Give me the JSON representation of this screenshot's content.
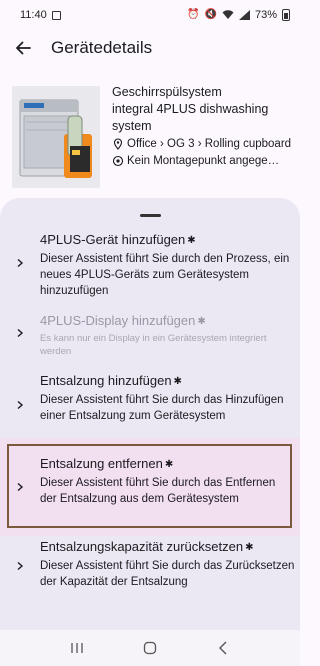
{
  "status_bar": {
    "time": "11:40",
    "battery": "73%"
  },
  "app_bar": {
    "title": "Gerätedetails"
  },
  "product": {
    "name": "Geschirrspülsystem",
    "model": "integral 4PLUS dishwashing system",
    "location": "Office › OG 3 › Rolling cupboard",
    "mount": "Kein Montagepunkt angege…"
  },
  "actions": [
    {
      "title": "4PLUS-Gerät hinzufügen",
      "desc": "Dieser Assistent führt Sie durch den Prozess, ein neues 4PLUS-Geräts zum Gerätesystem hinzuzufügen",
      "enabled": true
    },
    {
      "title": "4PLUS-Display hinzufügen",
      "desc": "Es kann nur ein Display in ein Gerätesystem integriert werden",
      "enabled": false
    },
    {
      "title": "Entsalzung hinzufügen",
      "desc": "Dieser Assistent führt Sie durch das Hinzufügen einer Entsalzung zum Gerätesystem",
      "enabled": true
    },
    {
      "title": "Entsalzung entfernen",
      "desc": "Dieser Assistent führt Sie durch das Entfernen der Entsalzung aus dem Gerätesystem",
      "enabled": true
    },
    {
      "title": "Entsalzungskapazität zurücksetzen",
      "desc": "Dieser Assistent führt Sie durch das Zurücksetzen der Kapazität der Entsalzung",
      "enabled": true
    }
  ],
  "icons": {
    "bluetooth": "bluetooth-icon",
    "chevron": "chevron-right-icon",
    "location": "location-pin-icon",
    "mount": "target-icon"
  },
  "colors": {
    "highlight_border": "#7b5a3b",
    "sheet_bg": "#ebe7f3",
    "disabled_text": "#9a98a3"
  }
}
